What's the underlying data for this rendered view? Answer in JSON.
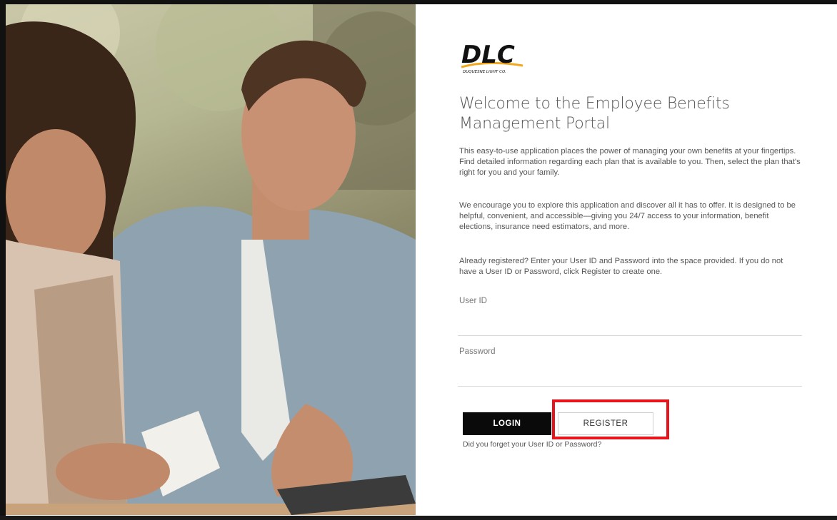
{
  "logo": {
    "text": "DLC",
    "tagline": "DUQUESNE LIGHT CO."
  },
  "header": {
    "title_line1": "Welcome to the Employee Benefits",
    "title_line2": "Management Portal"
  },
  "intro": {
    "paragraph1": "This easy-to-use application places the power of managing your own benefits at your fingertips. Find detailed information regarding each plan that is available to you. Then, select the plan that's right for you and your family.",
    "paragraph2": "We encourage you to explore this application and discover all it has to offer. It is designed to be helpful, convenient, and accessible—giving you 24/7 access to your information, benefit elections, insurance need estimators, and more.",
    "paragraph3": "Already registered? Enter your User ID and Password into the space provided. If you do not have a User ID or Password, click Register to create one."
  },
  "form": {
    "user_id_label": "User ID",
    "user_id_value": "",
    "password_label": "Password",
    "password_value": "",
    "login_label": "LOGIN",
    "register_label": "REGISTER",
    "forgot_text": "Did you forget your User ID or Password?"
  },
  "colors": {
    "login_bg": "#0a0a0a",
    "highlight": "#e8141b",
    "text": "#555555"
  }
}
